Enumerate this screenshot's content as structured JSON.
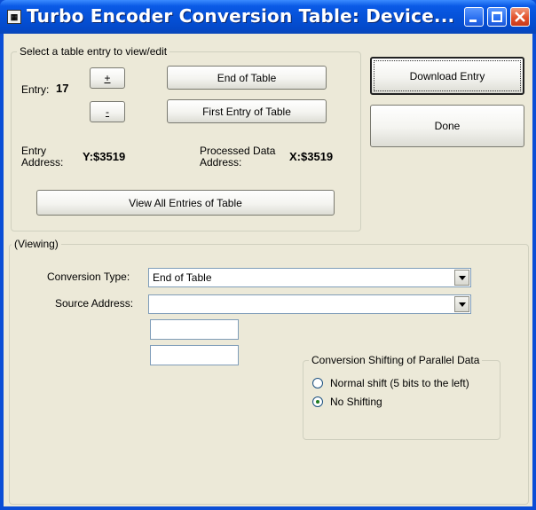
{
  "window": {
    "title": "Turbo Encoder Conversion Table: Device...",
    "app_icon": "app-icon",
    "title_buttons": [
      "minimize-icon",
      "maximize-icon",
      "close-icon"
    ]
  },
  "select_group": {
    "legend": "Select a table entry to view/edit",
    "entry_label": "Entry:",
    "entry_value": "17",
    "plus_label": "+",
    "minus_label": "-",
    "end_of_table_label": "End of Table",
    "first_entry_label": "First Entry of Table",
    "entry_address_label": "Entry\nAddress:",
    "entry_address_value": "Y:$3519",
    "processed_label": "Processed Data\nAddress:",
    "processed_value": "X:$3519",
    "view_all_label": "View All Entries of Table"
  },
  "actions": {
    "download_label": "Download Entry",
    "done_label": "Done"
  },
  "viewing_group": {
    "legend": "(Viewing)",
    "conversion_type_label": "Conversion Type:",
    "conversion_type_value": "End of Table",
    "source_address_label": "Source Address:",
    "source_address_value": "",
    "text1_value": "",
    "text2_value": ""
  },
  "shifting_group": {
    "legend": "Conversion Shifting of Parallel Data",
    "options": [
      {
        "label": "Normal shift (5 bits to the left)",
        "selected": false
      },
      {
        "label": "No Shifting",
        "selected": true
      }
    ]
  },
  "colors": {
    "titlebar": "#0550d6",
    "client_bg": "#ece9d8",
    "close_button": "#e2522c"
  }
}
